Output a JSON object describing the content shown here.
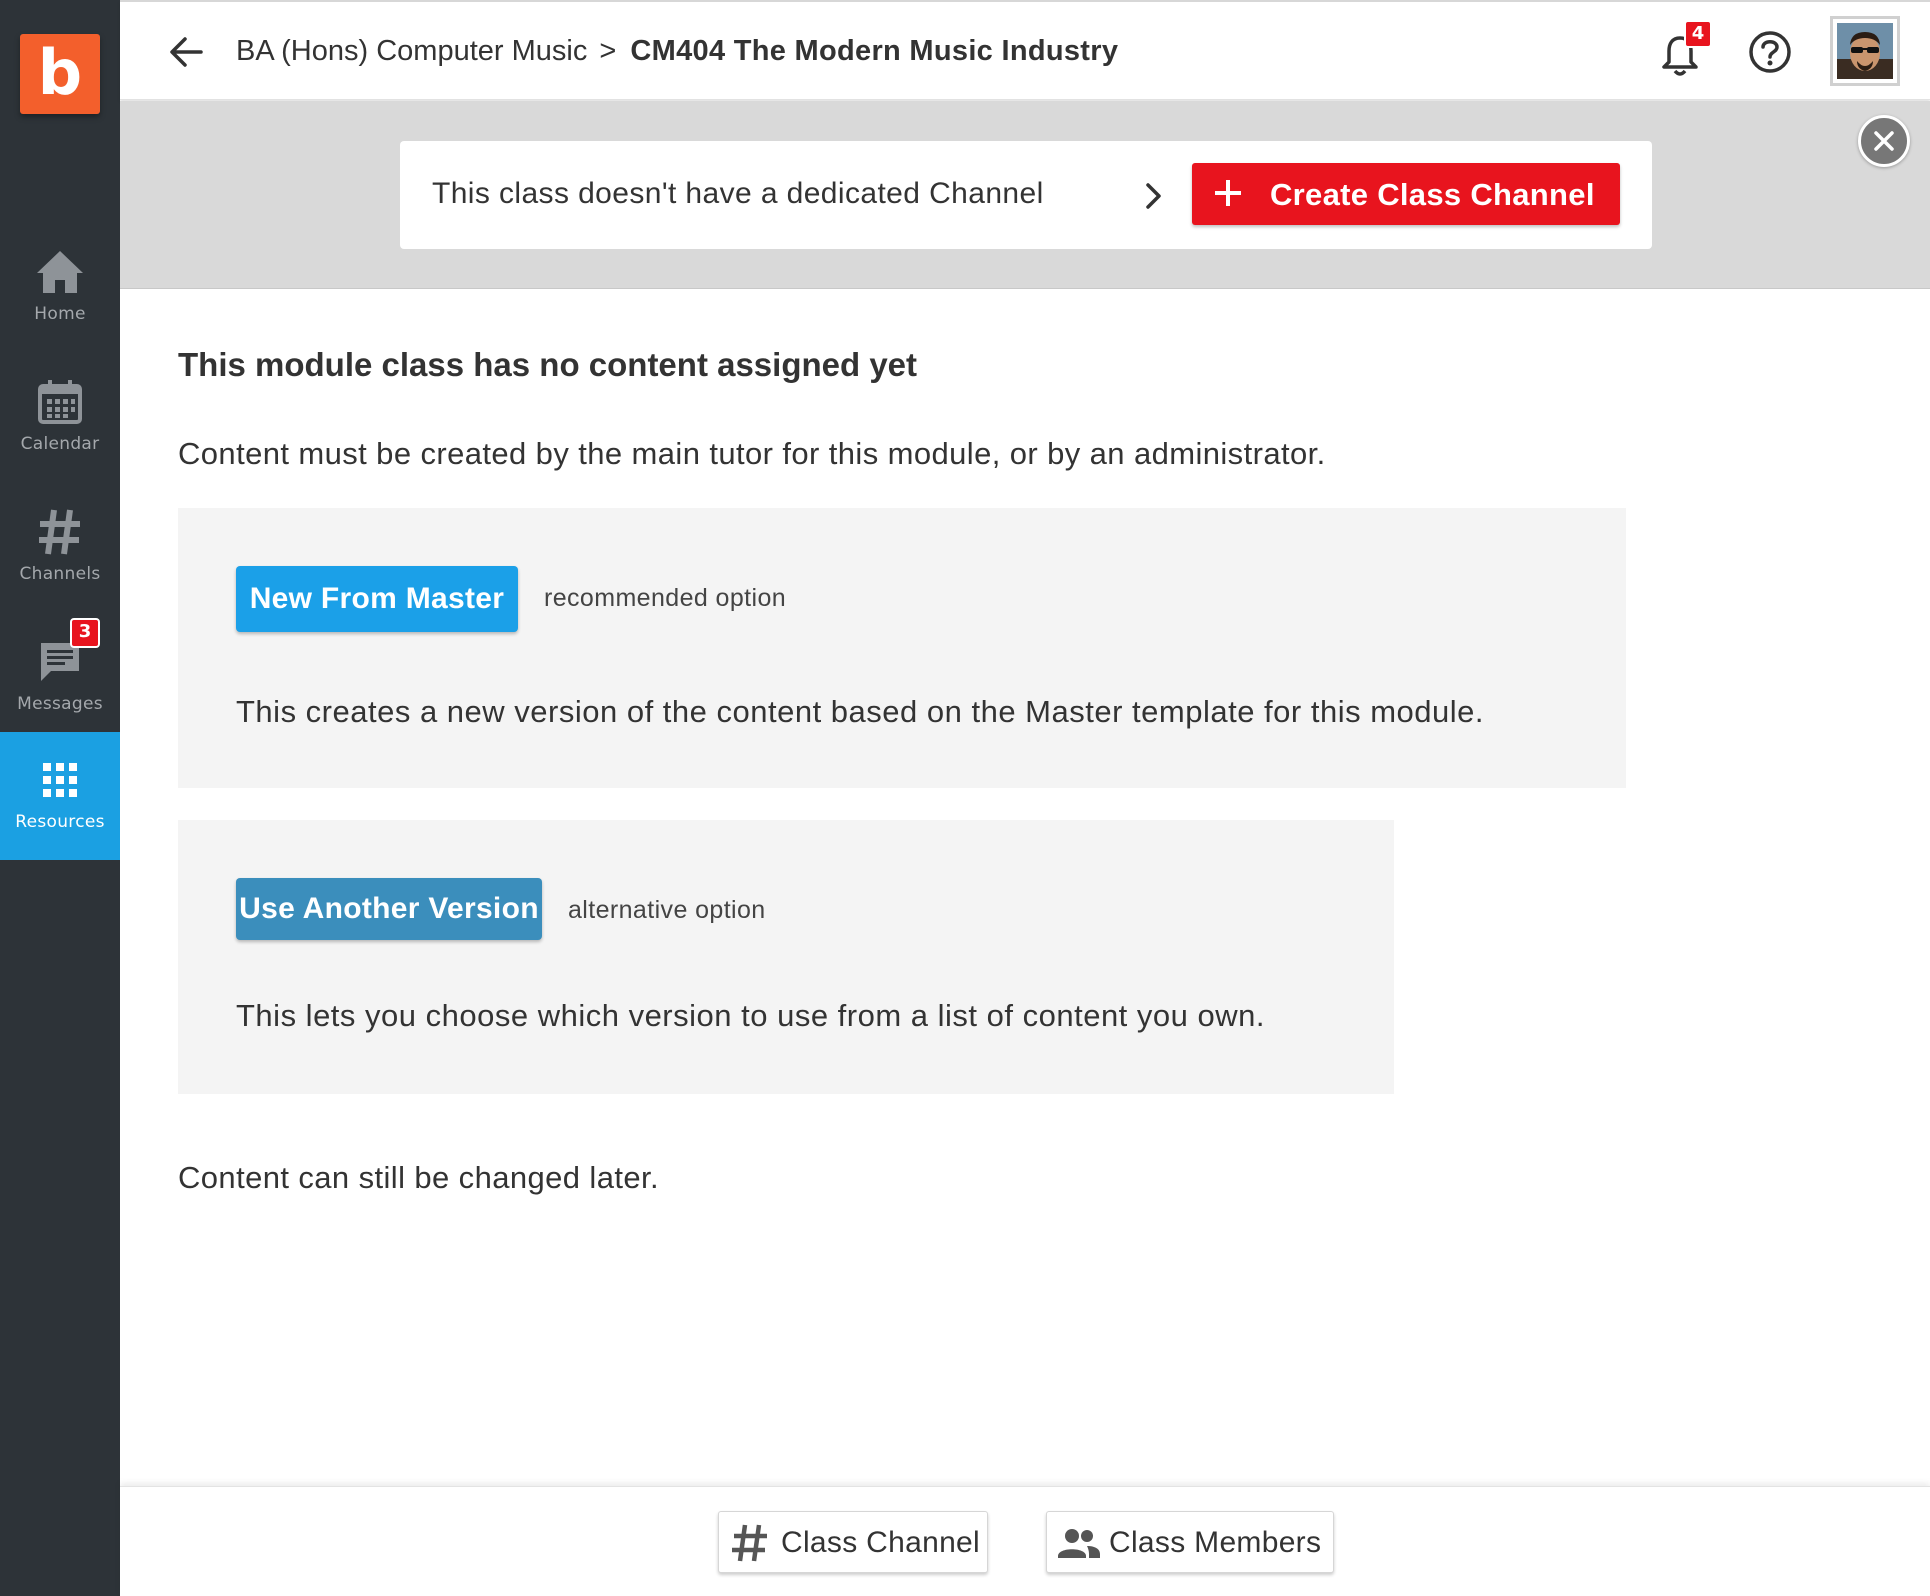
{
  "app": {
    "logo_letter": "b",
    "brand_color": "#f35f2c"
  },
  "sidebar": {
    "items": [
      {
        "label": "Home",
        "icon": "home-icon",
        "active": false
      },
      {
        "label": "Calendar",
        "icon": "calendar-icon",
        "active": false
      },
      {
        "label": "Channels",
        "icon": "hashtag-icon",
        "active": false
      },
      {
        "label": "Messages",
        "icon": "message-icon",
        "active": false,
        "badge": "3"
      },
      {
        "label": "Resources",
        "icon": "grid-icon",
        "active": true
      }
    ]
  },
  "header": {
    "breadcrumb_parent": "BA (Hons) Computer Music",
    "breadcrumb_separator": ">",
    "breadcrumb_current": "CM404 The Modern Music Industry",
    "notifications_badge": "4"
  },
  "banner": {
    "text": "This class doesn't have a dedicated Channel",
    "create_button": "Create Class Channel"
  },
  "main": {
    "heading": "This module class has no content assigned yet",
    "intro": "Content must be created by the main tutor for this module, or by an administrator.",
    "options": [
      {
        "button": "New From Master",
        "tag": "recommended option",
        "description": "This creates a new version of the content based on the Master template for this module."
      },
      {
        "button": "Use Another Version",
        "tag": "alternative option",
        "description": "This lets you choose which version to use from a list of content you own."
      }
    ],
    "footer_note": "Content can still be changed later."
  },
  "footer": {
    "class_channel": "Class Channel",
    "class_members": "Class Members"
  },
  "colors": {
    "sidebar_bg": "#2d3338",
    "active_nav": "#1ba0e2",
    "create_red": "#e8141e",
    "new_master_blue": "#1ba0e8",
    "another_version_blue": "#3b8ebc"
  }
}
